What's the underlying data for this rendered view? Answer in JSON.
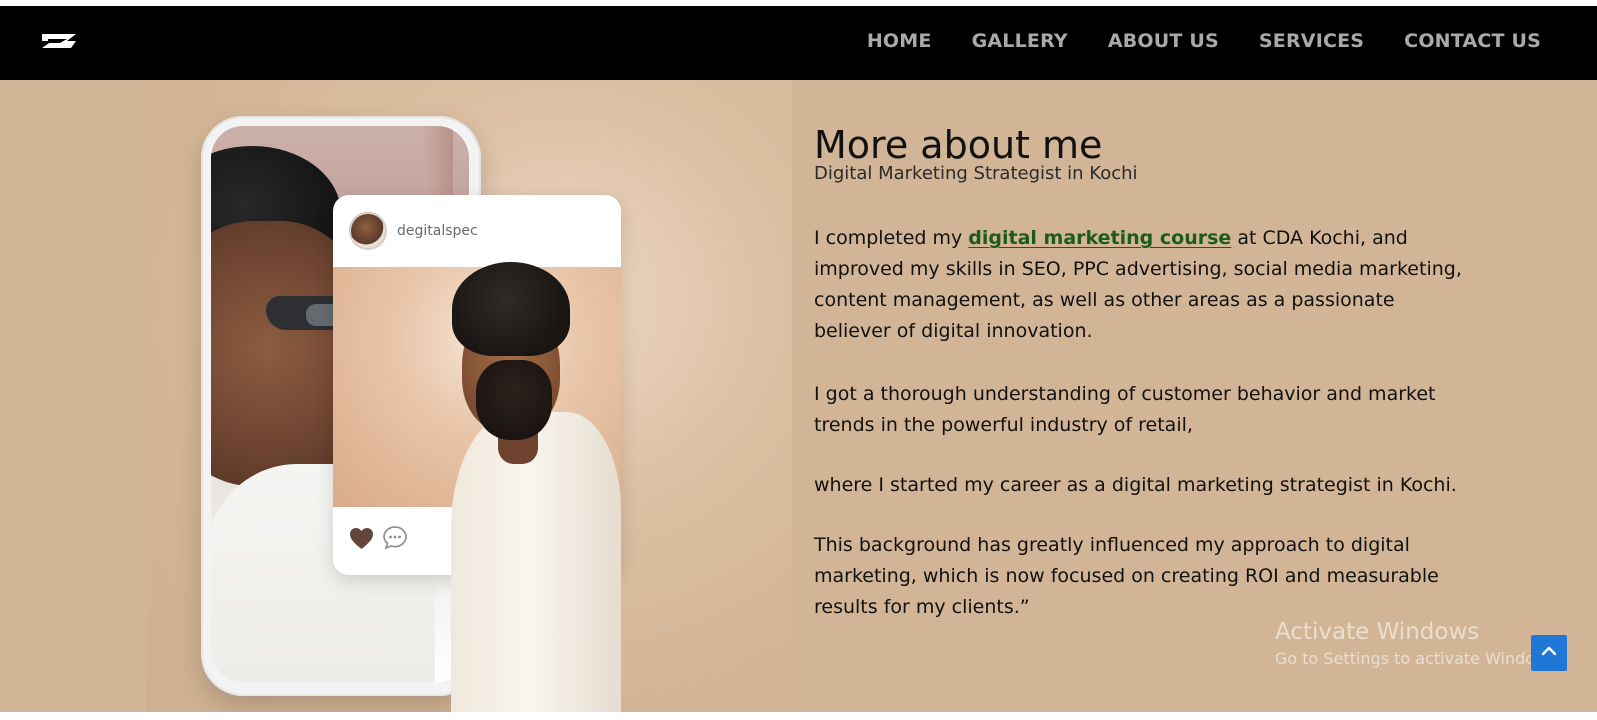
{
  "header": {
    "logo_icon": "brand-logo-icon",
    "nav": [
      {
        "label": "HOME"
      },
      {
        "label": "GALLERY"
      },
      {
        "label": "ABOUT US"
      },
      {
        "label": "SERVICES"
      },
      {
        "label": "CONTACT US"
      }
    ]
  },
  "hero": {
    "image": {
      "post_username": "degitalspec",
      "actions": [
        "heart-icon",
        "comment-icon"
      ]
    },
    "content": {
      "title": "More about me",
      "subtitle": "Digital Marketing Strategist in Kochi",
      "paragraph1": {
        "prefix": "I completed my ",
        "link_text": "digital marketing course",
        "suffix": " at CDA Kochi, and improved my skills in SEO, PPC advertising, social media marketing, content management, as well as other areas as a passionate believer of digital innovation."
      },
      "paragraph2": "I got a thorough understanding of customer behavior and market trends in the powerful industry of retail,",
      "paragraph3": "where I started my career as a digital marketing strategist in Kochi.",
      "paragraph4": "This background has greatly influenced my approach to digital marketing, which is now focused on creating ROI and measurable results for my clients.”"
    }
  },
  "overlay": {
    "watermark_title": "Activate Windows",
    "watermark_subtitle": "Go to Settings to activate Windows.",
    "back_to_top_icon": "chevron-up-icon"
  },
  "colors": {
    "header_background": "#000000",
    "page_background": "#d2b596",
    "link_green": "#1d5a1f",
    "nav_text": "#a9a9a9",
    "back_to_top": "#1f78d8"
  }
}
